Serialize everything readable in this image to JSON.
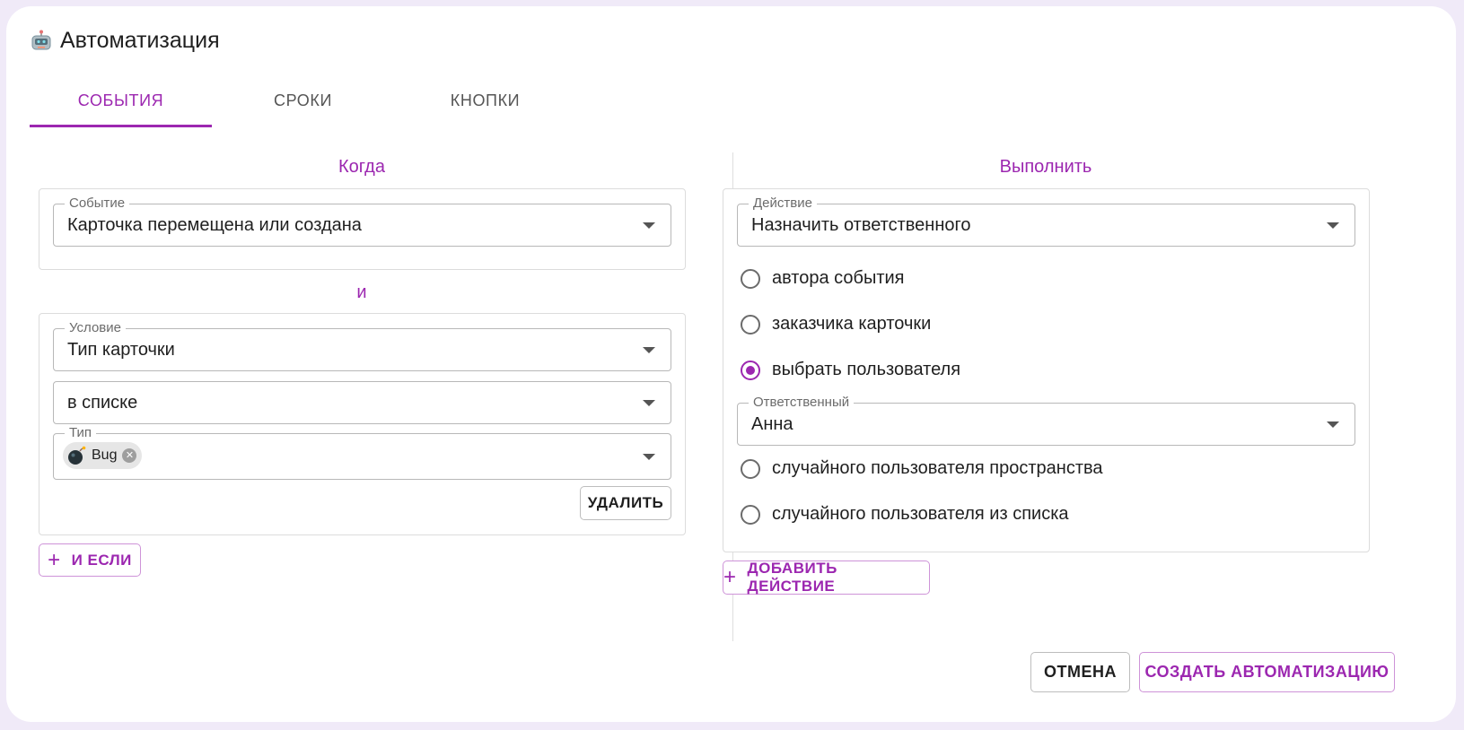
{
  "dialog": {
    "title": "Автоматизация",
    "tabs": [
      {
        "label": "СОБЫТИЯ",
        "active": true
      },
      {
        "label": "СРОКИ",
        "active": false
      },
      {
        "label": "КНОПКИ",
        "active": false
      }
    ]
  },
  "when": {
    "title": "Когда",
    "event": {
      "legend": "Событие",
      "value": "Карточка перемещена или создана"
    },
    "and_label": "и",
    "condition": {
      "legend": "Условие",
      "value": "Тип карточки",
      "operator": "в списке",
      "type_legend": "Тип",
      "type_chip": "Bug",
      "delete_label": "УДАЛИТЬ"
    },
    "add_if_label": "И ЕСЛИ"
  },
  "do": {
    "title": "Выполнить",
    "action": {
      "legend": "Действие",
      "value": "Назначить ответственного"
    },
    "options": [
      {
        "label": "автора события",
        "checked": false
      },
      {
        "label": "заказчика карточки",
        "checked": false
      },
      {
        "label": "выбрать пользователя",
        "checked": true
      },
      {
        "label": "случайного пользователя пространства",
        "checked": false
      },
      {
        "label": "случайного пользователя из списка",
        "checked": false
      }
    ],
    "assignee": {
      "legend": "Ответственный",
      "value": "Анна"
    },
    "add_action_label": "ДОБАВИТЬ ДЕЙСТВИЕ"
  },
  "footer": {
    "cancel_label": "ОТМЕНА",
    "create_label": "СОЗДАТЬ АВТОМАТИЗАЦИЮ"
  },
  "colors": {
    "accent": "#9c27b0",
    "accent_light": "#ce93d8",
    "frame": "#f0eaf8"
  },
  "icons": {
    "title_icon": "robot-icon",
    "chip_icon": "bomb-icon"
  }
}
